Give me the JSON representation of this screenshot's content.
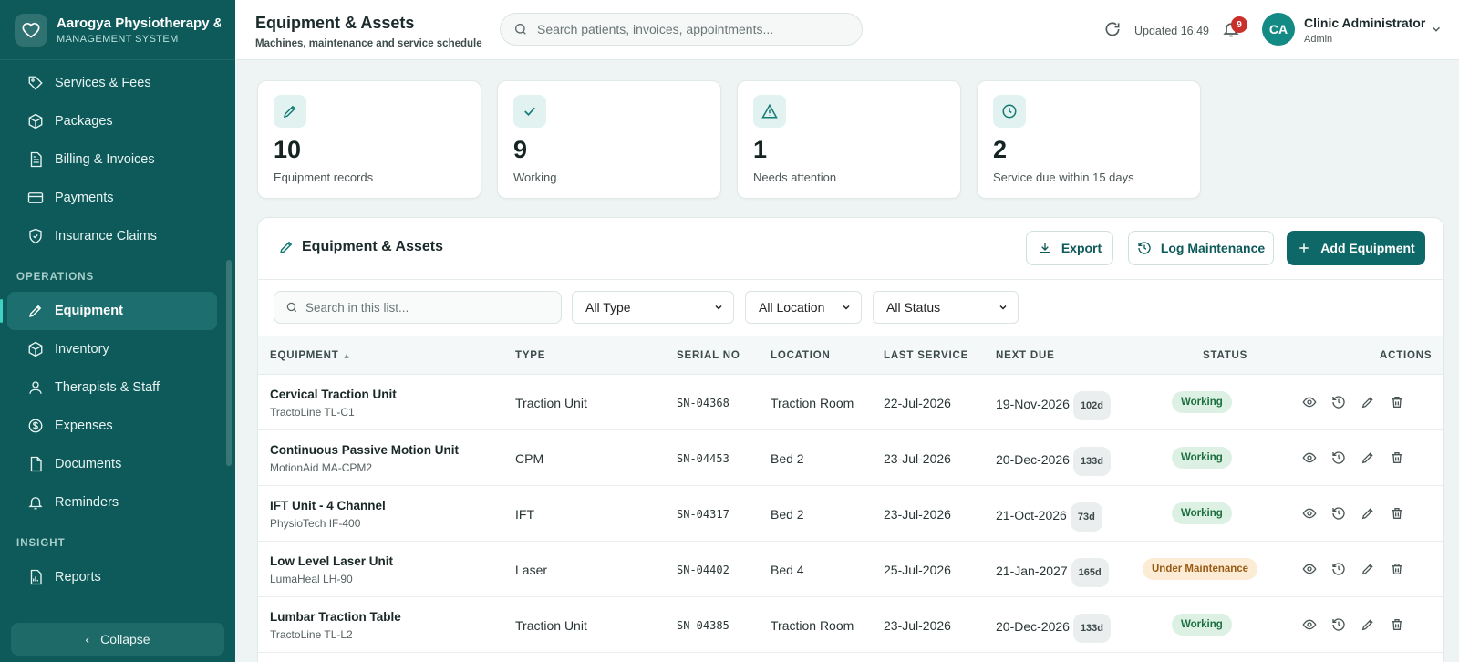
{
  "brand": {
    "title": "Aarogya Physiotherapy & I",
    "subtitle": "MANAGEMENT SYSTEM"
  },
  "sidebar": {
    "items_top": [
      {
        "label": "Services & Fees",
        "icon": "tag-icon"
      },
      {
        "label": "Packages",
        "icon": "box-icon"
      },
      {
        "label": "Billing & Invoices",
        "icon": "document-icon"
      },
      {
        "label": "Payments",
        "icon": "card-icon"
      },
      {
        "label": "Insurance Claims",
        "icon": "shield-icon"
      }
    ],
    "section_operations": "OPERATIONS",
    "items_operations": [
      {
        "label": "Equipment",
        "icon": "pencil-icon"
      },
      {
        "label": "Inventory",
        "icon": "box-icon"
      },
      {
        "label": "Therapists & Staff",
        "icon": "person-icon"
      },
      {
        "label": "Expenses",
        "icon": "dollar-icon"
      },
      {
        "label": "Documents",
        "icon": "file-icon"
      },
      {
        "label": "Reminders",
        "icon": "bell-icon"
      }
    ],
    "section_insight": "INSIGHT",
    "items_insight": [
      {
        "label": "Reports",
        "icon": "report-icon"
      }
    ],
    "collapse_label": "Collapse"
  },
  "header": {
    "title": "Equipment & Assets",
    "subtitle": "Machines, maintenance and service schedule",
    "search_placeholder": "Search patients, invoices, appointments...",
    "updated": "Updated 16:49",
    "notifications": "9",
    "user_initials": "CA",
    "user_name": "Clinic Administrator",
    "user_role": "Admin"
  },
  "stats": [
    {
      "value": "10",
      "label": "Equipment records",
      "icon": "pencil-icon"
    },
    {
      "value": "9",
      "label": "Working",
      "icon": "check-icon"
    },
    {
      "value": "1",
      "label": "Needs attention",
      "icon": "warning-icon"
    },
    {
      "value": "2",
      "label": "Service due within 15 days",
      "icon": "clock-icon"
    }
  ],
  "panel": {
    "title": "Equipment & Assets",
    "export_label": "Export",
    "log_label": "Log Maintenance",
    "add_label": "Add Equipment",
    "search_placeholder": "Search in this list...",
    "filter_type": "All Type",
    "filter_location": "All Location",
    "filter_status": "All Status"
  },
  "table": {
    "columns": [
      "EQUIPMENT",
      "TYPE",
      "SERIAL NO",
      "LOCATION",
      "LAST SERVICE",
      "NEXT DUE",
      "STATUS",
      "ACTIONS"
    ],
    "rows": [
      {
        "name": "Cervical Traction Unit",
        "model": "TractoLine TL-C1",
        "type": "Traction Unit",
        "serial": "SN-04368",
        "location": "Traction Room",
        "last": "22-Jul-2026",
        "next": "19-Nov-2026",
        "days": "102d",
        "status": "Working"
      },
      {
        "name": "Continuous Passive Motion Unit",
        "model": "MotionAid MA-CPM2",
        "type": "CPM",
        "serial": "SN-04453",
        "location": "Bed 2",
        "last": "23-Jul-2026",
        "next": "20-Dec-2026",
        "days": "133d",
        "status": "Working"
      },
      {
        "name": "IFT Unit - 4 Channel",
        "model": "PhysioTech IF-400",
        "type": "IFT",
        "serial": "SN-04317",
        "location": "Bed 2",
        "last": "23-Jul-2026",
        "next": "21-Oct-2026",
        "days": "73d",
        "status": "Working"
      },
      {
        "name": "Low Level Laser Unit",
        "model": "LumaHeal LH-90",
        "type": "Laser",
        "serial": "SN-04402",
        "location": "Bed 4",
        "last": "25-Jul-2026",
        "next": "21-Jan-2027",
        "days": "165d",
        "status": "Under Maintenance"
      },
      {
        "name": "Lumbar Traction Table",
        "model": "TractoLine TL-L2",
        "type": "Traction Unit",
        "serial": "SN-04385",
        "location": "Traction Room",
        "last": "23-Jul-2026",
        "next": "20-Dec-2026",
        "days": "133d",
        "status": "Working"
      }
    ]
  },
  "colors": {
    "sidebar": "#0e5a5a",
    "primary": "#0f6868",
    "accent": "#3fd1c3",
    "working": "#1c6e3e",
    "maintenance": "#9a5a12"
  }
}
